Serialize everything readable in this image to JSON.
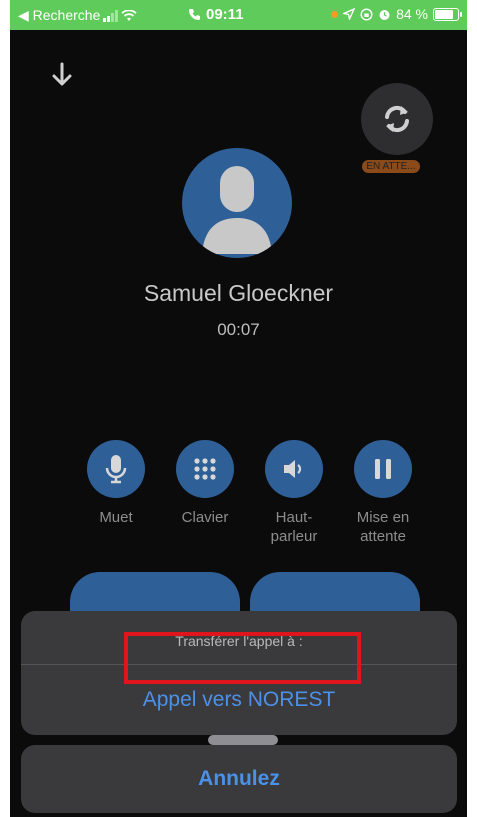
{
  "status_bar": {
    "back_label": "◀ Recherche",
    "time": "09:11",
    "battery_percent": "84 %",
    "battery_level": 0.84
  },
  "call": {
    "caller_name": "Samuel Gloeckner",
    "duration": "00:07",
    "hold_badge": "EN ATTE..."
  },
  "controls": [
    {
      "label": "Muet",
      "icon": "microphone-icon"
    },
    {
      "label": "Clavier",
      "icon": "keypad-icon"
    },
    {
      "label": "Haut-\nparleur",
      "icon": "speaker-icon"
    },
    {
      "label": "Mise en\nattente",
      "icon": "pause-icon"
    }
  ],
  "action_sheet": {
    "title": "Transférer l'appel à :",
    "action": "Appel vers NOREST",
    "cancel": "Annulez"
  },
  "colors": {
    "accent": "#2f5f97",
    "link": "#4b91e8",
    "highlight": "#e0141b",
    "status_bar": "#5fcb5a"
  }
}
